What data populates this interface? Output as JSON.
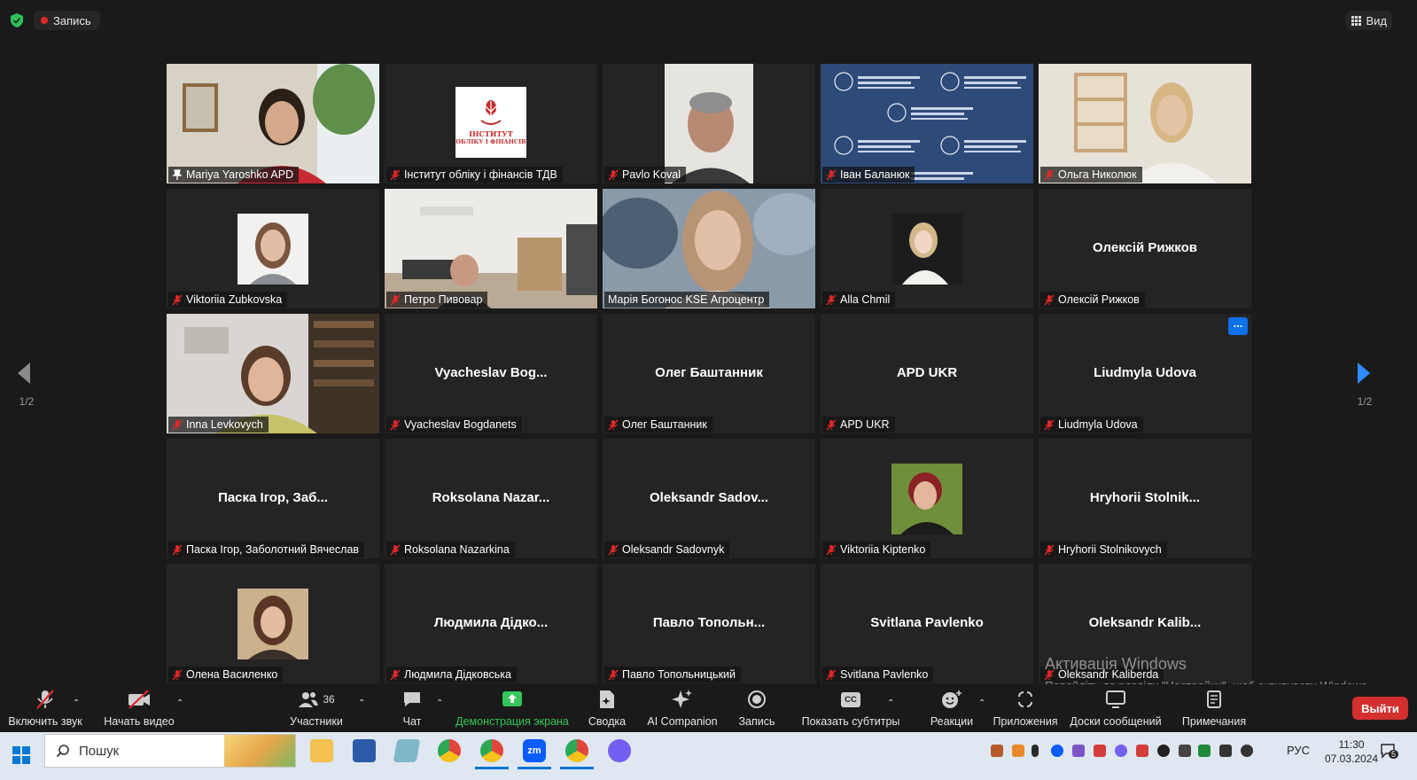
{
  "topbar": {
    "recording_label": "Запись",
    "view_label": "Вид"
  },
  "pagination": {
    "left": "1/2",
    "right": "1/2"
  },
  "tiles": [
    {
      "name": "Mariya Yaroshko APD",
      "display": "",
      "type": "video",
      "pinned": true
    },
    {
      "name": "Інститут обліку і фінансів ТДВ",
      "display": "",
      "type": "logo",
      "logo_line1": "ІНСТИТУТ",
      "logo_line2": "ОБЛІКУ І ФІНАНСІВ"
    },
    {
      "name": "Pavlo Koval",
      "display": "",
      "type": "video"
    },
    {
      "name": "Іван Баланюк",
      "display": "",
      "type": "banner"
    },
    {
      "name": "Ольга Николюк",
      "display": "",
      "type": "video"
    },
    {
      "name": "Viktoriia Zubkovska",
      "display": "",
      "type": "thumb"
    },
    {
      "name": "Петро Пивовар",
      "display": "",
      "type": "video"
    },
    {
      "name": "Марія Богонос KSE Агроцентр",
      "display": "",
      "type": "video",
      "active": true
    },
    {
      "name": "Alla Chmil",
      "display": "",
      "type": "thumb"
    },
    {
      "name": "Олексій Рижков",
      "display": "Олексій Рижков",
      "type": "name"
    },
    {
      "name": "Inna Levkovych",
      "display": "",
      "type": "video"
    },
    {
      "name": "Vyacheslav Bogdanets",
      "display": "Vyacheslav  Bog...",
      "type": "name"
    },
    {
      "name": "Олег Баштанник",
      "display": "Олег Баштанник",
      "type": "name"
    },
    {
      "name": "APD UKR",
      "display": "APD UKR",
      "type": "name"
    },
    {
      "name": "Liudmyla Udova",
      "display": "Liudmyla Udova",
      "type": "name",
      "more": "..."
    },
    {
      "name": "Паска Ігор, Заболотний Вячеслав",
      "display": "Паска Ігор, Заб...",
      "type": "name"
    },
    {
      "name": "Roksolana Nazarkina",
      "display": "Roksolana  Nazar...",
      "type": "name"
    },
    {
      "name": "Oleksandr Sadovnyk",
      "display": "Oleksandr  Sadov...",
      "type": "name"
    },
    {
      "name": "Viktoriia Kiptenko",
      "display": "",
      "type": "thumb"
    },
    {
      "name": "Hryhorii Stolnikovych",
      "display": "Hryhorii  Stolnik...",
      "type": "name"
    },
    {
      "name": "Олена Василенко",
      "display": "",
      "type": "thumb"
    },
    {
      "name": "Людмила Дідковська",
      "display": "Людмила  Дідко...",
      "type": "name"
    },
    {
      "name": "Павло Топольницький",
      "display": "Павло  Топольн...",
      "type": "name"
    },
    {
      "name": "Svitlana Pavlenko",
      "display": "Svitlana Pavlenko",
      "type": "name"
    },
    {
      "name": "Oleksandr Kaliberda",
      "display": "Oleksandr  Kalib...",
      "type": "name"
    }
  ],
  "toolbar": {
    "unmute": "Включить звук",
    "start_video": "Начать видео",
    "participants": "Участники",
    "participants_count": "36",
    "chat": "Чат",
    "share": "Демонстрация экрана",
    "summary": "Сводка",
    "companion": "AI Companion",
    "record": "Запись",
    "captions": "Показать субтитры",
    "captions_icon": "CC",
    "reactions": "Реакции",
    "apps": "Приложения",
    "whiteboards": "Доски сообщений",
    "notes": "Примечания",
    "leave": "Выйти"
  },
  "watermark": {
    "title": "Активація Windows",
    "text": "Перейдіть до розділу \"Настройки\", щоб активувати Windows."
  },
  "taskbar": {
    "search_placeholder": "Пошук",
    "zoom_label": "zm",
    "lang": "РУС",
    "time": "11:30",
    "date": "07.03.2024",
    "notif_count": "5"
  },
  "colors": {
    "accent_blue": "#0e71eb",
    "share_green": "#34c75a",
    "leave_red": "#d32f2f",
    "active_border": "#c8d64a",
    "mic_red": "#e02828"
  }
}
